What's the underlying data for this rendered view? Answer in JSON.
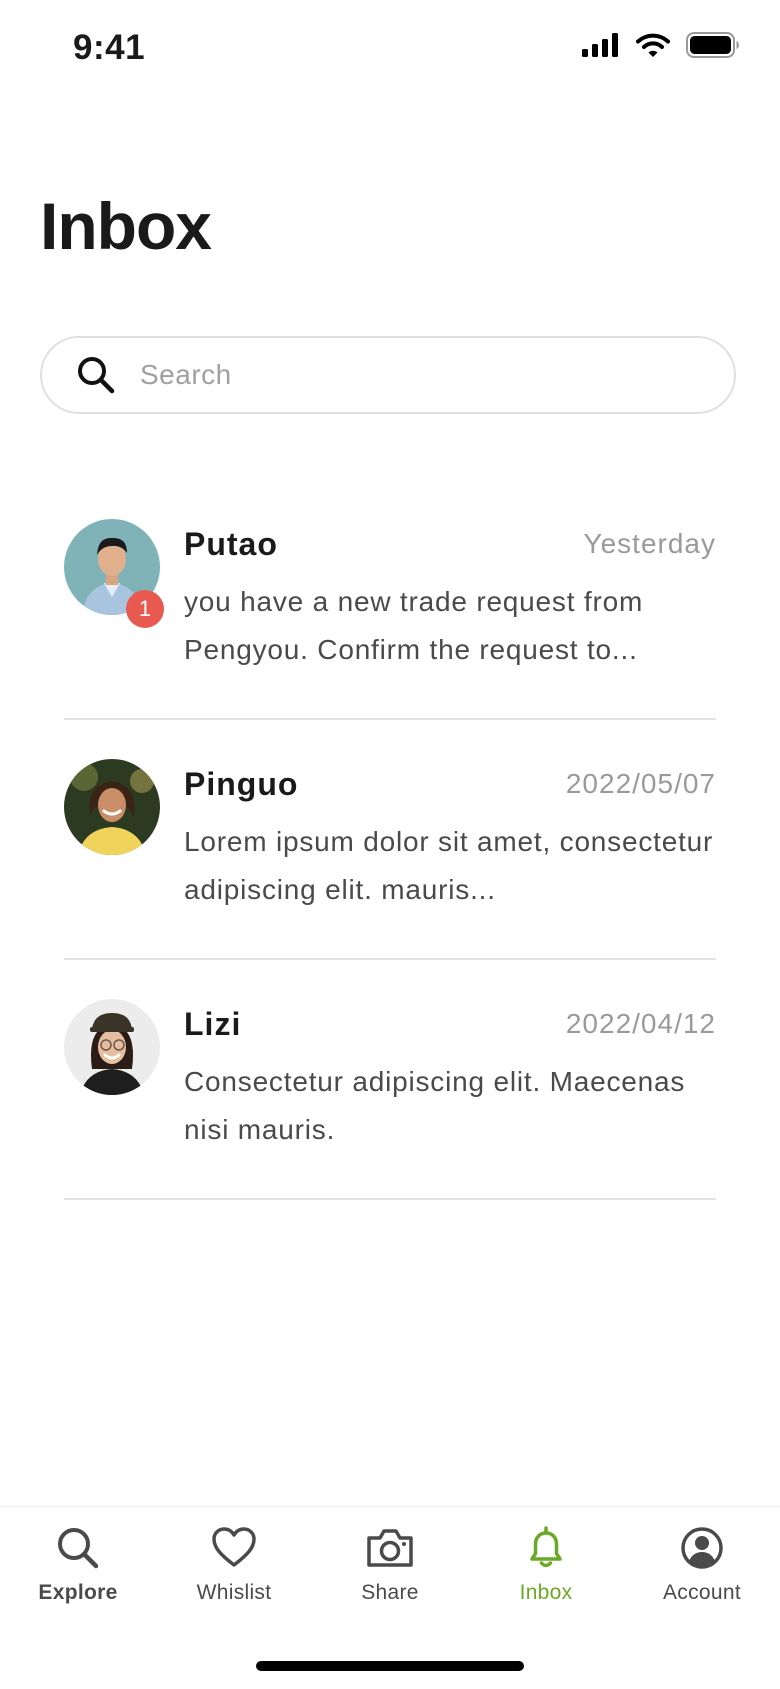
{
  "status_bar": {
    "time": "9:41"
  },
  "page": {
    "title": "Inbox"
  },
  "search": {
    "placeholder": "Search"
  },
  "messages": [
    {
      "sender": "Putao",
      "date": "Yesterday",
      "preview": "you have a new trade request from Pengyou. Confirm the request to...",
      "unread_count": "1"
    },
    {
      "sender": "Pinguo",
      "date": "2022/05/07",
      "preview": "Lorem ipsum dolor sit amet, consectetur adipiscing elit. mauris..."
    },
    {
      "sender": "Lizi",
      "date": "2022/04/12",
      "preview": "Consectetur adipiscing elit. Maecenas nisi mauris."
    }
  ],
  "tabs": [
    {
      "label": "Explore",
      "icon": "search-icon"
    },
    {
      "label": "Whislist",
      "icon": "heart-icon"
    },
    {
      "label": "Share",
      "icon": "camera-icon"
    },
    {
      "label": "Inbox",
      "icon": "bell-icon",
      "active": true
    },
    {
      "label": "Account",
      "icon": "user-circle-icon"
    }
  ],
  "colors": {
    "accent": "#6aa925",
    "badge": "#e85a4f"
  }
}
